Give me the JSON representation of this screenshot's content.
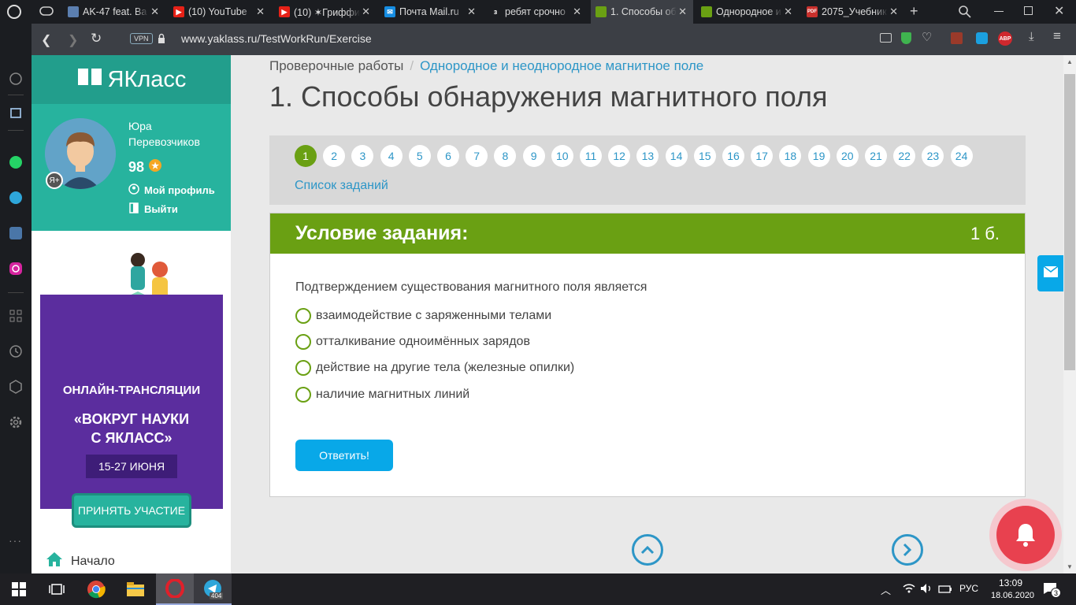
{
  "browser": {
    "tabs": [
      {
        "title": "AK-47 feat. Ba",
        "icon": "chat-icon"
      },
      {
        "title": "(10) YouTube",
        "icon": "youtube-icon"
      },
      {
        "title": "(10) ✶Гриффи",
        "icon": "youtube-icon"
      },
      {
        "title": "Почта Mail.ru",
        "icon": "mail-icon"
      },
      {
        "title": "ребят срочно",
        "icon": "znanija-icon"
      },
      {
        "title": "1. Способы об",
        "icon": "yaklass-icon"
      },
      {
        "title": "Однородное и",
        "icon": "yaklass-icon"
      },
      {
        "title": "2075_Учебник",
        "icon": "pdf-icon"
      }
    ],
    "znanija_badge": "з",
    "pdf_badge": "PDF",
    "vpn_label": "VPN",
    "abp_label": "ABP",
    "url": "www.yaklass.ru/TestWorkRun/Exercise"
  },
  "site": {
    "logo": "ЯКласс",
    "user": {
      "first": "Юра",
      "last": "Перевозчиков",
      "score": "98",
      "badge": "Я+",
      "profile": "Мой профиль",
      "logout": "Выйти"
    },
    "promo": {
      "line1": "ОНЛАЙН-ТРАНСЛЯЦИИ",
      "line2": "«ВОКРУГ НАУКИ",
      "line3": "С ЯКЛАСС»",
      "dates": "15-27 ИЮНЯ",
      "button": "ПРИНЯТЬ УЧАСТИЕ"
    },
    "home_label": "Начало"
  },
  "main": {
    "breadcrumb_root": "Проверочные работы",
    "breadcrumb_sep": "/",
    "breadcrumb_link": "Однородное и неоднородное магнитное поле",
    "title": "1. Способы обнаружения магнитного поля",
    "question_numbers": [
      "1",
      "2",
      "3",
      "4",
      "5",
      "6",
      "7",
      "8",
      "9",
      "10",
      "11",
      "12",
      "13",
      "14",
      "15",
      "16",
      "17",
      "18",
      "19",
      "20",
      "21",
      "22",
      "23",
      "24"
    ],
    "current_question": "1",
    "task_list": "Список заданий",
    "card_header": "Условие задания:",
    "points": "1 б.",
    "question": "Подтверждением существования магнитного поля является",
    "options": [
      "взаимодействие с заряженными телами",
      "отталкивание одноимённых зарядов",
      "действие на другие тела (железные опилки)",
      "наличие магнитных линий"
    ],
    "answer_button": "Ответить!"
  },
  "taskbar": {
    "time": "13:09",
    "date": "18.06.2020",
    "lang": "РУС",
    "notifications": "3",
    "telegram_badge": "404"
  },
  "colors": {
    "accent_green": "#6aa013",
    "teal": "#27b39e",
    "link_blue": "#2d96c7",
    "promo_purple": "#5b2d9e"
  }
}
